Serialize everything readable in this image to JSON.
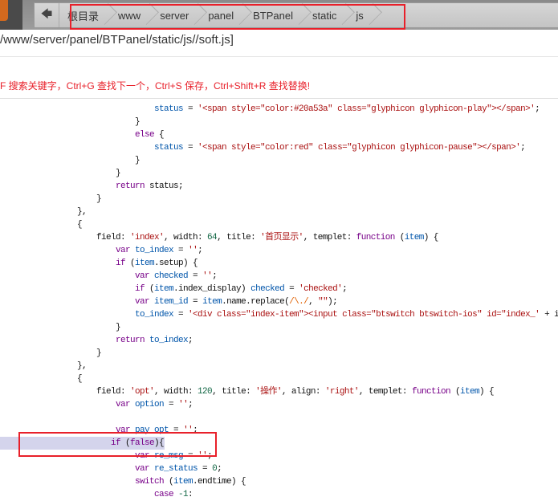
{
  "breadcrumb": {
    "back_icon": "arrow-left-icon",
    "items": [
      "根目录",
      "www",
      "server",
      "panel",
      "BTPanel",
      "static",
      "js"
    ]
  },
  "file_path": "/www/server/panel/BTPanel/static/js//soft.js]",
  "hint": "F 搜索关键字，Ctrl+G 查找下一个，Ctrl+S 保存，Ctrl+Shift+R 查找替换!",
  "colors": {
    "keyword": "#770088",
    "variable": "#0055aa",
    "string": "#aa1111",
    "number": "#116644",
    "highlight": "#d4d4ec",
    "annotation": "#e8202a"
  },
  "code": [
    {
      "i": 4,
      "t": [
        [
          "var",
          "status"
        ],
        [
          "p",
          " = "
        ],
        [
          "str",
          "'<span style=\"color:#20a53a\" class=\"glyphicon glyphicon-play\"></span>'"
        ],
        [
          "p",
          ";"
        ]
      ]
    },
    {
      "i": 3,
      "t": [
        [
          "p",
          "}"
        ]
      ]
    },
    {
      "i": 3,
      "t": [
        [
          "kw",
          "else"
        ],
        [
          "p",
          " {"
        ]
      ]
    },
    {
      "i": 4,
      "t": [
        [
          "var",
          "status"
        ],
        [
          "p",
          " = "
        ],
        [
          "str",
          "'<span style=\"color:red\" class=\"glyphicon glyphicon-pause\"></span>'"
        ],
        [
          "p",
          ";"
        ]
      ]
    },
    {
      "i": 3,
      "t": [
        [
          "p",
          "}"
        ]
      ]
    },
    {
      "i": 2,
      "t": [
        [
          "p",
          "}"
        ]
      ]
    },
    {
      "i": 2,
      "t": [
        [
          "kw",
          "return"
        ],
        [
          "p",
          " status;"
        ]
      ]
    },
    {
      "i": 1,
      "t": [
        [
          "p",
          "}"
        ]
      ]
    },
    {
      "i": 0,
      "t": [
        [
          "p",
          "},"
        ]
      ]
    },
    {
      "i": 0,
      "t": [
        [
          "p",
          "{"
        ]
      ]
    },
    {
      "i": 1,
      "t": [
        [
          "p",
          "field: "
        ],
        [
          "str",
          "'index'"
        ],
        [
          "p",
          ", width: "
        ],
        [
          "num",
          "64"
        ],
        [
          "p",
          ", title: "
        ],
        [
          "str",
          "'首页显示'"
        ],
        [
          "p",
          ", templet: "
        ],
        [
          "kw",
          "function"
        ],
        [
          "p",
          " ("
        ],
        [
          "var",
          "item"
        ],
        [
          "p",
          ") {"
        ]
      ]
    },
    {
      "i": 2,
      "t": [
        [
          "kw",
          "var"
        ],
        [
          "p",
          " "
        ],
        [
          "var",
          "to_index"
        ],
        [
          "p",
          " = "
        ],
        [
          "str",
          "''"
        ],
        [
          "p",
          ";"
        ]
      ]
    },
    {
      "i": 2,
      "t": [
        [
          "kw",
          "if"
        ],
        [
          "p",
          " ("
        ],
        [
          "var",
          "item"
        ],
        [
          "p",
          ".setup) {"
        ]
      ]
    },
    {
      "i": 3,
      "t": [
        [
          "kw",
          "var"
        ],
        [
          "p",
          " "
        ],
        [
          "var",
          "checked"
        ],
        [
          "p",
          " = "
        ],
        [
          "str",
          "''"
        ],
        [
          "p",
          ";"
        ]
      ]
    },
    {
      "i": 3,
      "t": [
        [
          "kw",
          "if"
        ],
        [
          "p",
          " ("
        ],
        [
          "var",
          "item"
        ],
        [
          "p",
          ".index_display) "
        ],
        [
          "var",
          "checked"
        ],
        [
          "p",
          " = "
        ],
        [
          "str",
          "'checked'"
        ],
        [
          "p",
          ";"
        ]
      ]
    },
    {
      "i": 3,
      "t": [
        [
          "kw",
          "var"
        ],
        [
          "p",
          " "
        ],
        [
          "var",
          "item_id"
        ],
        [
          "p",
          " = "
        ],
        [
          "var",
          "item"
        ],
        [
          "p",
          ".name.replace("
        ],
        [
          "re",
          "/\\./"
        ],
        [
          "p",
          ", "
        ],
        [
          "str",
          "\"\""
        ],
        [
          "p",
          ");"
        ]
      ]
    },
    {
      "i": 3,
      "t": [
        [
          "var",
          "to_index"
        ],
        [
          "p",
          " = "
        ],
        [
          "str",
          "'<div class=\"index-item\"><input class=\"btswitch btswitch-ios\" id=\"index_'"
        ],
        [
          "p",
          " + i"
        ]
      ]
    },
    {
      "i": 2,
      "t": [
        [
          "p",
          "}"
        ]
      ]
    },
    {
      "i": 2,
      "t": [
        [
          "kw",
          "return"
        ],
        [
          "p",
          " "
        ],
        [
          "var",
          "to_index"
        ],
        [
          "p",
          ";"
        ]
      ]
    },
    {
      "i": 1,
      "t": [
        [
          "p",
          "}"
        ]
      ]
    },
    {
      "i": 0,
      "t": [
        [
          "p",
          "},"
        ]
      ]
    },
    {
      "i": 0,
      "t": [
        [
          "p",
          "{"
        ]
      ]
    },
    {
      "i": 1,
      "t": [
        [
          "p",
          "field: "
        ],
        [
          "str",
          "'opt'"
        ],
        [
          "p",
          ", width: "
        ],
        [
          "num",
          "120"
        ],
        [
          "p",
          ", title: "
        ],
        [
          "str",
          "'操作'"
        ],
        [
          "p",
          ", align: "
        ],
        [
          "str",
          "'right'"
        ],
        [
          "p",
          ", templet: "
        ],
        [
          "kw",
          "function"
        ],
        [
          "p",
          " ("
        ],
        [
          "var",
          "item"
        ],
        [
          "p",
          ") {"
        ]
      ]
    },
    {
      "i": 2,
      "t": [
        [
          "kw",
          "var"
        ],
        [
          "p",
          " "
        ],
        [
          "var",
          "option"
        ],
        [
          "p",
          " = "
        ],
        [
          "str",
          "''"
        ],
        [
          "p",
          ";"
        ]
      ]
    },
    {
      "i": 0,
      "t": []
    },
    {
      "i": 2,
      "t": [
        [
          "kw",
          "var"
        ],
        [
          "p",
          " "
        ],
        [
          "var",
          "pay_opt"
        ],
        [
          "p",
          " = "
        ],
        [
          "str",
          "''"
        ],
        [
          "p",
          ";"
        ]
      ]
    },
    {
      "i": 2,
      "hl": true,
      "t": [
        [
          "kw",
          "if"
        ],
        [
          "p",
          " ("
        ],
        [
          "kw",
          "false"
        ],
        [
          "p",
          "){"
        ]
      ]
    },
    {
      "i": 3,
      "t": [
        [
          "kw",
          "var"
        ],
        [
          "p",
          " "
        ],
        [
          "var",
          "re_msg"
        ],
        [
          "p",
          " = "
        ],
        [
          "str",
          "''"
        ],
        [
          "p",
          ";"
        ]
      ]
    },
    {
      "i": 3,
      "t": [
        [
          "kw",
          "var"
        ],
        [
          "p",
          " "
        ],
        [
          "var",
          "re_status"
        ],
        [
          "p",
          " = "
        ],
        [
          "num",
          "0"
        ],
        [
          "p",
          ";"
        ]
      ]
    },
    {
      "i": 3,
      "t": [
        [
          "kw",
          "switch"
        ],
        [
          "p",
          " ("
        ],
        [
          "var",
          "item"
        ],
        [
          "p",
          ".endtime) {"
        ]
      ]
    },
    {
      "i": 4,
      "t": [
        [
          "kw",
          "case"
        ],
        [
          "p",
          " "
        ],
        [
          "num",
          "-1"
        ],
        [
          "p",
          ":"
        ]
      ]
    }
  ]
}
